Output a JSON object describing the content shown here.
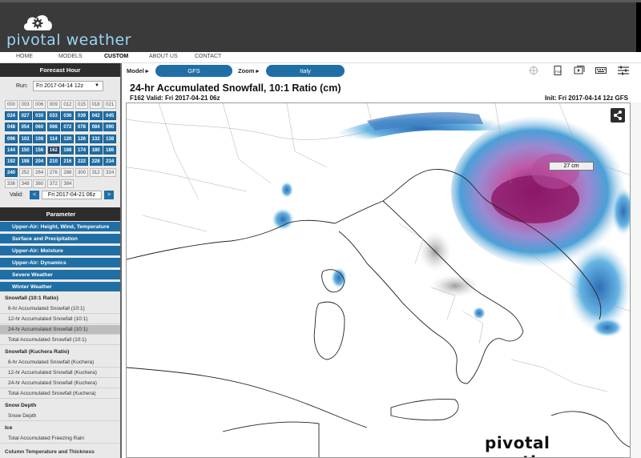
{
  "brand": {
    "name": "pivotal weather"
  },
  "nav": {
    "items": [
      "HOME",
      "MODELS",
      "CUSTOM",
      "ABOUT US",
      "CONTACT"
    ],
    "active": "CUSTOM"
  },
  "sidebar": {
    "forecast_hour_title": "Forecast Hour",
    "run_label": "Run:",
    "run_value": "Fri 2017-04-14 12z",
    "hours": [
      "000",
      "003",
      "006",
      "009",
      "012",
      "015",
      "018",
      "021",
      "024",
      "027",
      "030",
      "033",
      "036",
      "039",
      "042",
      "045",
      "048",
      "054",
      "060",
      "066",
      "072",
      "078",
      "084",
      "090",
      "096",
      "102",
      "108",
      "114",
      "120",
      "126",
      "132",
      "138",
      "144",
      "150",
      "156",
      "162",
      "168",
      "174",
      "180",
      "186",
      "192",
      "198",
      "204",
      "210",
      "216",
      "222",
      "228",
      "234",
      "240",
      "252",
      "264",
      "276",
      "288",
      "300",
      "312",
      "324",
      "336",
      "348",
      "360",
      "372",
      "384"
    ],
    "selected_hour": "162",
    "valid_label": "Valid:",
    "valid_value": "Fri 2017-04-21 06z",
    "parameter_title": "Parameter",
    "categories": [
      "Upper-Air: Height, Wind, Temperature",
      "Surface and Precipitation",
      "Upper-Air: Moisture",
      "Upper-Air: Dynamics",
      "Severe Weather",
      "Winter Weather"
    ],
    "sections": [
      {
        "title": "Snowfall (10:1 Ratio)",
        "items": [
          "6-hr Accumulated Snowfall (10:1)",
          "12-hr Accumulated Snowfall (10:1)",
          "24-hr Accumulated Snowfall (10:1)",
          "Total Accumulated Snowfall (10:1)"
        ]
      },
      {
        "title": "Snowfall (Kuchera Ratio)",
        "items": [
          "6-hr Accumulated Snowfall (Kuchera)",
          "12-hr Accumulated Snowfall (Kuchera)",
          "24-hr Accumulated Snowfall (Kuchera)",
          "Total Accumulated Snowfall (Kuchera)"
        ]
      },
      {
        "title": "Snow Depth",
        "items": [
          "Snow Depth"
        ]
      },
      {
        "title": "Ice",
        "items": [
          "Total Accumulated Freezing Rain"
        ]
      }
    ],
    "selected_item": "24-hr Accumulated Snowfall (10:1)",
    "cut_off_text": "Column Temperature and Thickness"
  },
  "toolbar": {
    "model_label": "Model ▸",
    "model_value": "GFS",
    "zoom_label": "Zoom ▸",
    "zoom_value": "Italy"
  },
  "map": {
    "title": "24-hr Accumulated Snowfall, 10:1 Ratio (cm)",
    "subtitle": "F162 Valid: Fri 2017-04-21 06z",
    "init": "Init: Fri 2017-04-14 12z GFS",
    "label": "27 cm",
    "watermark": "pivotal weather"
  },
  "colors": {
    "accent": "#1f6fa6",
    "header_bg": "#3a3a3a",
    "brand_text": "#9ad4f5"
  }
}
